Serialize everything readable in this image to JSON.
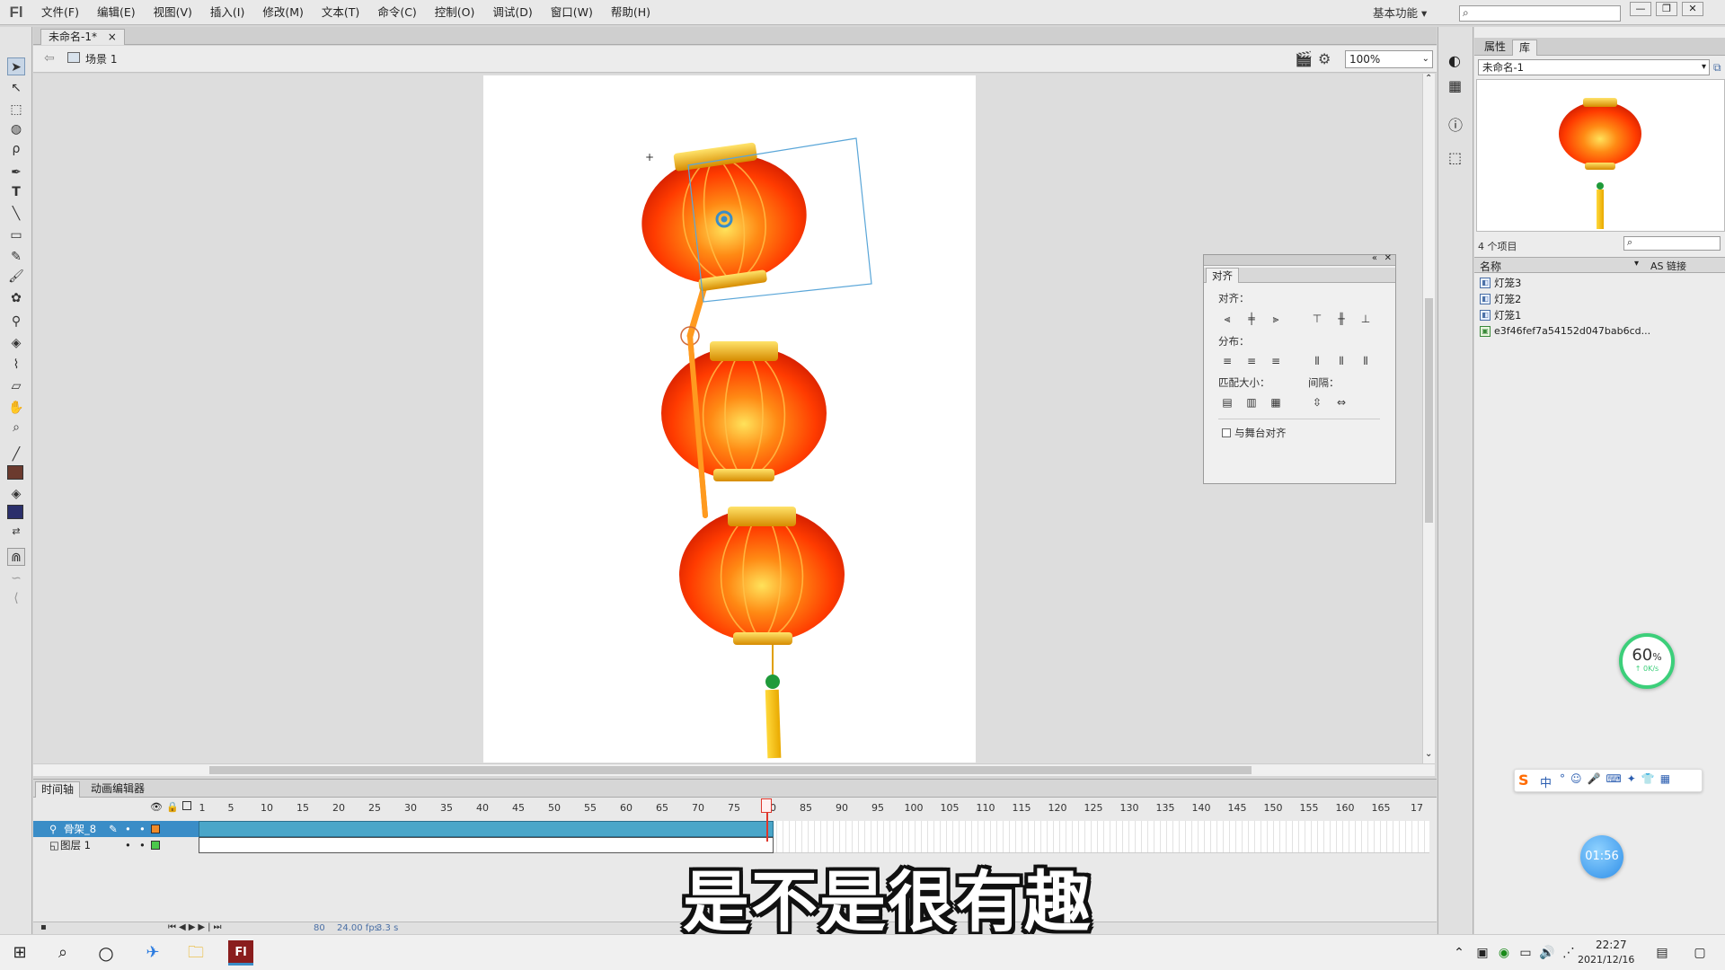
{
  "app": {
    "logo": "Fl",
    "menu": [
      "文件(F)",
      "编辑(E)",
      "视图(V)",
      "插入(I)",
      "修改(M)",
      "文本(T)",
      "命令(C)",
      "控制(O)",
      "调试(D)",
      "窗口(W)",
      "帮助(H)"
    ],
    "workspace": "基本功能 ▾",
    "window_buttons": [
      "—",
      "❐",
      "✕"
    ]
  },
  "document": {
    "tab_title": "未命名-1*",
    "tab_close": "×",
    "scene_label": "场景 1",
    "zoom": "100%"
  },
  "align_panel": {
    "tab": "对齐",
    "align_label": "对齐：",
    "distribute_label": "分布：",
    "match_size_label": "匹配大小：",
    "spacing_label": "间隔：",
    "stage_checkbox_label": "与舞台对齐",
    "stage_checked": false
  },
  "library": {
    "tabs": [
      "属性",
      "库"
    ],
    "active_tab": "库",
    "document": "未命名-1",
    "item_count": "4 个项目",
    "col_name": "名称",
    "col_link": "AS 链接",
    "items": [
      {
        "name": "灯笼3",
        "icon": "movieclip-icon"
      },
      {
        "name": "灯笼2",
        "icon": "movieclip-icon"
      },
      {
        "name": "灯笼1",
        "icon": "movieclip-icon"
      },
      {
        "name": "e3f46fef7a54152d047bab6cd...",
        "icon": "bitmap-icon"
      }
    ]
  },
  "timeline": {
    "tabs": [
      "时间轴",
      "动画编辑器"
    ],
    "ruler": [
      1,
      5,
      10,
      15,
      20,
      25,
      30,
      35,
      40,
      45,
      50,
      55,
      60,
      65,
      70,
      75,
      80,
      85,
      90,
      95,
      100,
      105,
      110,
      115,
      120,
      125,
      130,
      135,
      140,
      145,
      150,
      155,
      160,
      165,
      17
    ],
    "layers": [
      {
        "name": "骨架_8",
        "selected": true
      },
      {
        "name": "图层 1",
        "selected": false
      }
    ],
    "current_frame": "80",
    "fps": "24.00 fps",
    "elapsed": "3.3 s",
    "playhead_frame": 80
  },
  "overlay": {
    "subtitle": "是不是很有趣",
    "net_percent": "60",
    "net_unit": "%",
    "net_speed": "↑ 0K/s",
    "timer": "01:56"
  },
  "taskbar": {
    "time": "22:27",
    "date": "2021/12/16",
    "ime": "中"
  },
  "colors": {
    "accent": "#3a8dc7",
    "layer_selected": "#3a8dc7",
    "playhead": "#e0362b",
    "lantern": "#ff3d00"
  }
}
